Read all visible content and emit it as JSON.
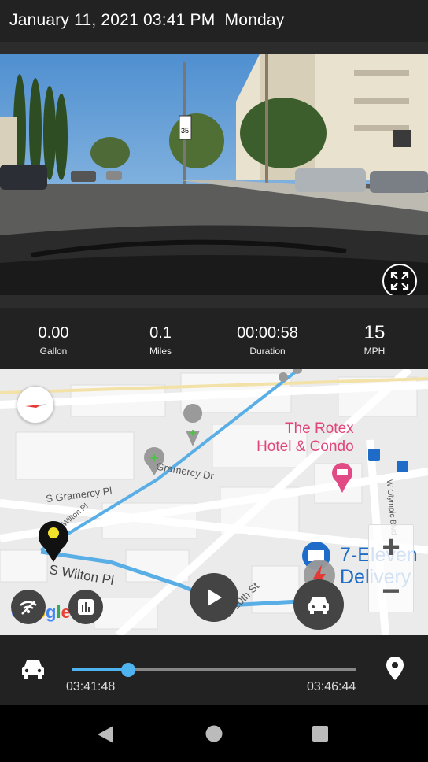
{
  "header": {
    "datetime": "January 11, 2021 03:41 PM",
    "weekday": "Monday"
  },
  "video": {
    "fullscreen_icon": "fullscreen-expand-icon",
    "speed_sign": "35"
  },
  "stats": [
    {
      "value": "0.00",
      "unit": "Gallon"
    },
    {
      "value": "0.1",
      "unit": "Miles"
    },
    {
      "value": "00:00:58",
      "unit": "Duration"
    },
    {
      "value": "15",
      "unit": "MPH"
    }
  ],
  "map": {
    "street_labels": [
      "S Gramercy Pl",
      "Gramercy Dr",
      "S Wilton Pl",
      "W 10th St",
      "Wilton Pl",
      "W Olympic Blvd"
    ],
    "poi_rotex": [
      "The Rotex",
      "Hotel & Condo"
    ],
    "poi_7eleven": [
      "7-Eleven",
      "Delivery"
    ],
    "zoom_in": "+",
    "zoom_out": "−",
    "google_logo": "Google",
    "route_color": "#5aaee6",
    "icons": [
      "compass-icon",
      "signal-icon",
      "stats-chart-icon",
      "play-icon",
      "car-icon",
      "hard-acceleration-icon",
      "location-pin-icon"
    ]
  },
  "timeline": {
    "start": "03:41:48",
    "end": "03:46:44",
    "progress": 0.2,
    "accent": "#4fb3ef"
  },
  "navbar": {
    "icons": [
      "back-icon",
      "home-icon",
      "recents-icon"
    ]
  }
}
